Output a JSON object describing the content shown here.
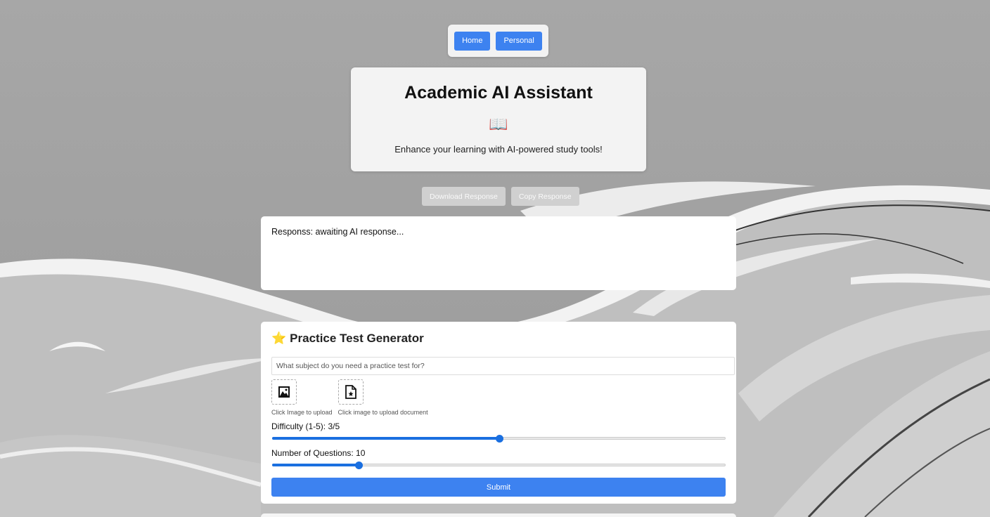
{
  "nav": {
    "home_label": "Home",
    "personal_label": "Personal"
  },
  "header": {
    "title": "Academic AI Assistant",
    "emoji": "📖",
    "subtitle": "Enhance your learning with AI-powered study tools!"
  },
  "actions": {
    "download_label": "Download Response",
    "copy_label": "Copy Response"
  },
  "response": {
    "text": "Responss: awaiting AI response..."
  },
  "generator": {
    "icon": "star-icon",
    "title": "Practice Test Generator",
    "subject_placeholder": "What subject do you need a practice test for?",
    "upload_image_label": "Click Image to upload",
    "upload_doc_label": "Click image to upload document",
    "difficulty_label": "Difficulty (1-5): 3/5",
    "difficulty_value": 3,
    "difficulty_max": 5,
    "questions_label": "Number of Questions: 10",
    "questions_value": 10,
    "submit_label": "Submit"
  },
  "colors": {
    "accent": "#3d82f0",
    "slider": "#1a6fe0",
    "disabled": "#d0d0d0"
  }
}
